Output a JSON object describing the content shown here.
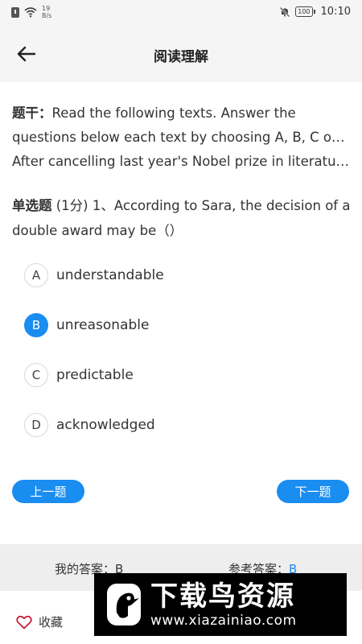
{
  "status_bar": {
    "net_speed_value": "19",
    "net_speed_unit": "B/s",
    "battery": "100",
    "time": "10:10"
  },
  "header": {
    "title": "阅读理解"
  },
  "stem": {
    "label": "题干：",
    "line1": "Read the following texts. Answer the",
    "line2": "questions below each text by choosing A, B, C or D.",
    "line3": "After cancelling last year's Nobel prize in literatur…"
  },
  "question": {
    "type_label": "单选题",
    "score": "(1分)",
    "text": "1、According to Sara, the decision of a double award may be（）"
  },
  "options": [
    {
      "letter": "A",
      "text": "understandable",
      "selected": false
    },
    {
      "letter": "B",
      "text": "unreasonable",
      "selected": true
    },
    {
      "letter": "C",
      "text": "predictable",
      "selected": false
    },
    {
      "letter": "D",
      "text": "acknowledged",
      "selected": false
    }
  ],
  "nav": {
    "prev_label": "上一题",
    "next_label": "下一题"
  },
  "answers": {
    "my_answer_label": "我的答案：",
    "my_answer_value": "B",
    "ref_answer_label": "参考答案：",
    "ref_answer_value": "B"
  },
  "bottom": {
    "favorite_label": "收藏"
  },
  "watermark": {
    "main": "下载鸟资源",
    "url": "www.xiazainiao.com"
  },
  "colors": {
    "accent": "#1a8df0",
    "header_bg": "#f5f5f5",
    "answer_bar_bg": "#eeeeee"
  },
  "icons": {
    "back": "arrow-left-icon",
    "favorite": "heart-outline-icon",
    "wifi": "wifi-icon",
    "mute": "mute-icon"
  }
}
